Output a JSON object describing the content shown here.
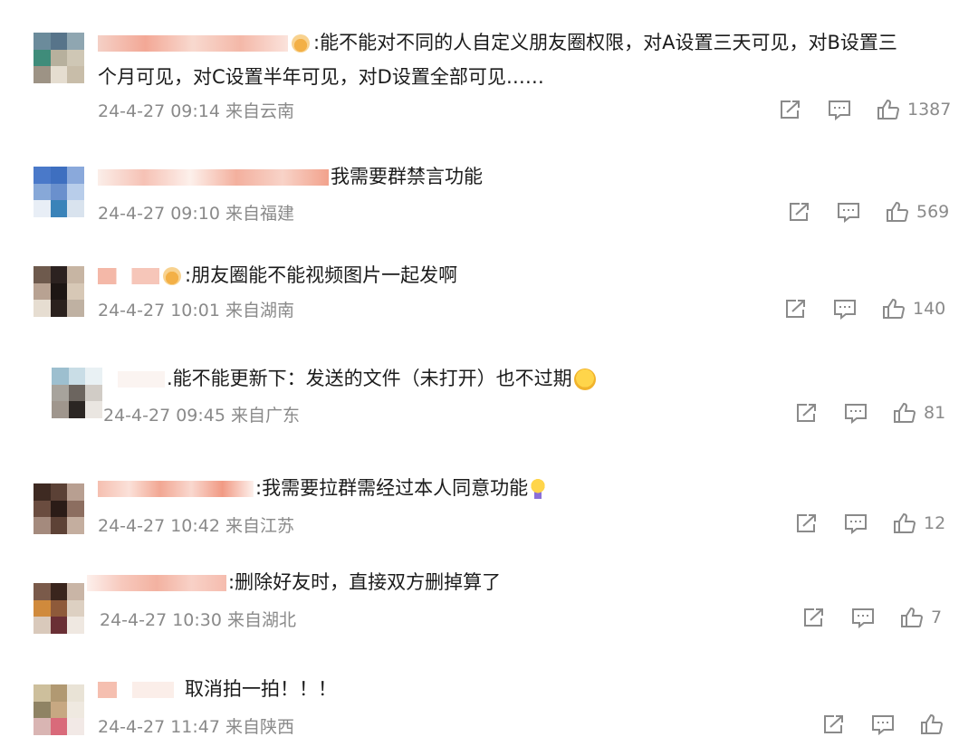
{
  "comments": [
    {
      "text": ":能不能对不同的人自定义朋友圈权限，对A设置三天可见，对B设置三",
      "text2": "个月可见，对C设置半年可见，对D设置全部可见……",
      "time": "24-4-27 09:14 来自云南",
      "likes": "1387"
    },
    {
      "text": "我需要群禁言功能",
      "time": "24-4-27 09:10 来自福建",
      "likes": "569"
    },
    {
      "text": ":朋友圈能不能视频图片一起发啊",
      "time": "24-4-27 10:01 来自湖南",
      "likes": "140"
    },
    {
      "text": ".能不能更新下：发送的文件（未打开）也不过期",
      "time": "24-4-27 09:45 来自广东",
      "likes": "81"
    },
    {
      "text": ":我需要拉群需经过本人同意功能",
      "time": "24-4-27 10:42 来自江苏",
      "likes": "12"
    },
    {
      "text": ":删除好友时，直接双方删掉算了",
      "time": "24-4-27 10:30 来自湖北",
      "likes": "7"
    },
    {
      "text": "取消拍一拍！！！",
      "time": "24-4-27 11:47 来自陕西",
      "likes": ""
    }
  ],
  "icons": {
    "share": "share-icon",
    "comment": "comment-icon",
    "like": "thumbs-up-icon"
  },
  "colors": {
    "text": "#1b1b1b",
    "meta": "#8a8a8a",
    "icon": "#8a8a8a"
  }
}
